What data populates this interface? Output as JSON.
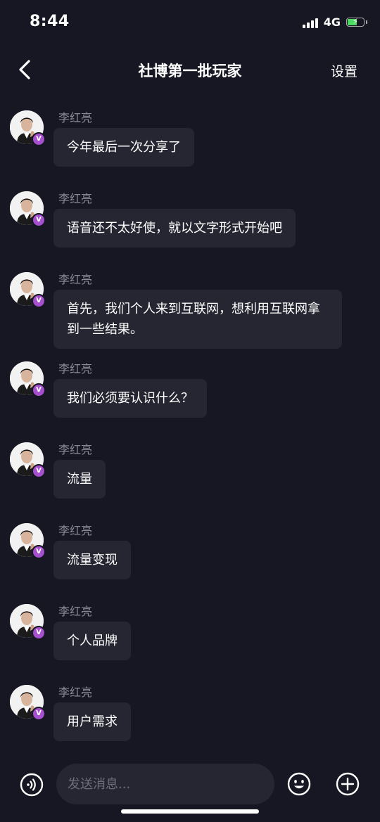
{
  "status_bar": {
    "time": "8:44",
    "network": "4G"
  },
  "header": {
    "title": "社博第一批玩家",
    "settings_label": "设置"
  },
  "badge_label": "V",
  "messages": [
    {
      "sender": "李红亮",
      "text": "今年最后一次分享了"
    },
    {
      "sender": "李红亮",
      "text": "语音还不太好使，就以文字形式开始吧"
    },
    {
      "sender": "李红亮",
      "text": "首先，我们个人来到互联网，想利用互联网拿到一些结果。"
    },
    {
      "sender": "李红亮",
      "text": "我们必须要认识什么？"
    },
    {
      "sender": "李红亮",
      "text": "流量"
    },
    {
      "sender": "李红亮",
      "text": "流量变现"
    },
    {
      "sender": "李红亮",
      "text": "个人品牌"
    },
    {
      "sender": "李红亮",
      "text": "用户需求"
    }
  ],
  "input": {
    "placeholder": "发送消息..."
  },
  "icons": {
    "back": "chevron-left-icon",
    "voice": "voice-wave-icon",
    "emoji": "smiley-icon",
    "plus": "plus-circle-icon"
  },
  "colors": {
    "background": "#161722",
    "bubble": "#252631",
    "badge": "#a64fcf",
    "battery": "#4cd964"
  }
}
